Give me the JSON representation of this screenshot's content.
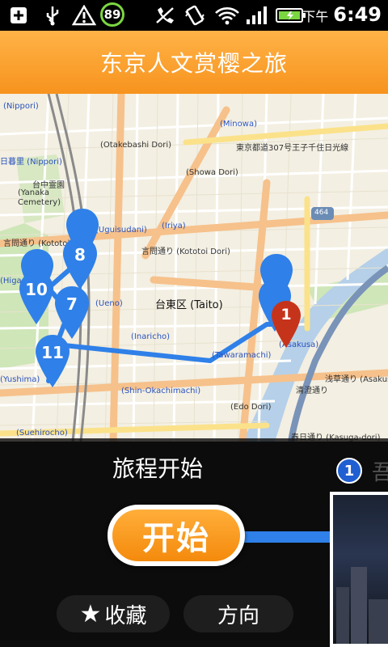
{
  "status_bar": {
    "battery_percent": "89",
    "ampm": "下午",
    "time": "6:49",
    "icons": [
      "add-icon",
      "usb-icon",
      "warning-icon",
      "phone-off-icon",
      "vibrate-icon",
      "wifi-icon",
      "signal-icon",
      "battery-icon"
    ]
  },
  "header": {
    "title": "东京人文赏樱之旅"
  },
  "map": {
    "district_label": "台東区 (Taito)",
    "labels": [
      "(Nippori)",
      "日暮里 (Nippori)",
      "台中霊園",
      "(Yanaka",
      "Cemetery)",
      "言問通り (Kototoi Dori)",
      "(Uguisudani)",
      "言問通り (Kototoi Dori)",
      "(Iriya)",
      "(Minowa)",
      "東京都道307号王子千住日光線",
      "(Otakebashi Dori)",
      "(Showa Dori)",
      "464",
      "(Ueno)",
      "(Inaricho)",
      "(Tawaramachi)",
      "(Asakusa)",
      "(Shin-Okachimachi)",
      "(Edo Dori)",
      "清澄通り",
      "浅草通り (Asakusa",
      "(Yushima)",
      "(Suehirocho)",
      "春日通り (Kasuga-dori)",
      "(Higa"
    ],
    "pins": [
      "8",
      "7",
      "10",
      "11",
      "1"
    ]
  },
  "panel": {
    "title": "旅程开始",
    "start_label": "开始",
    "favorite_label": "收藏",
    "direction_label": "方向",
    "thumb_index": "1",
    "thumb_overflow_char": "吾"
  }
}
